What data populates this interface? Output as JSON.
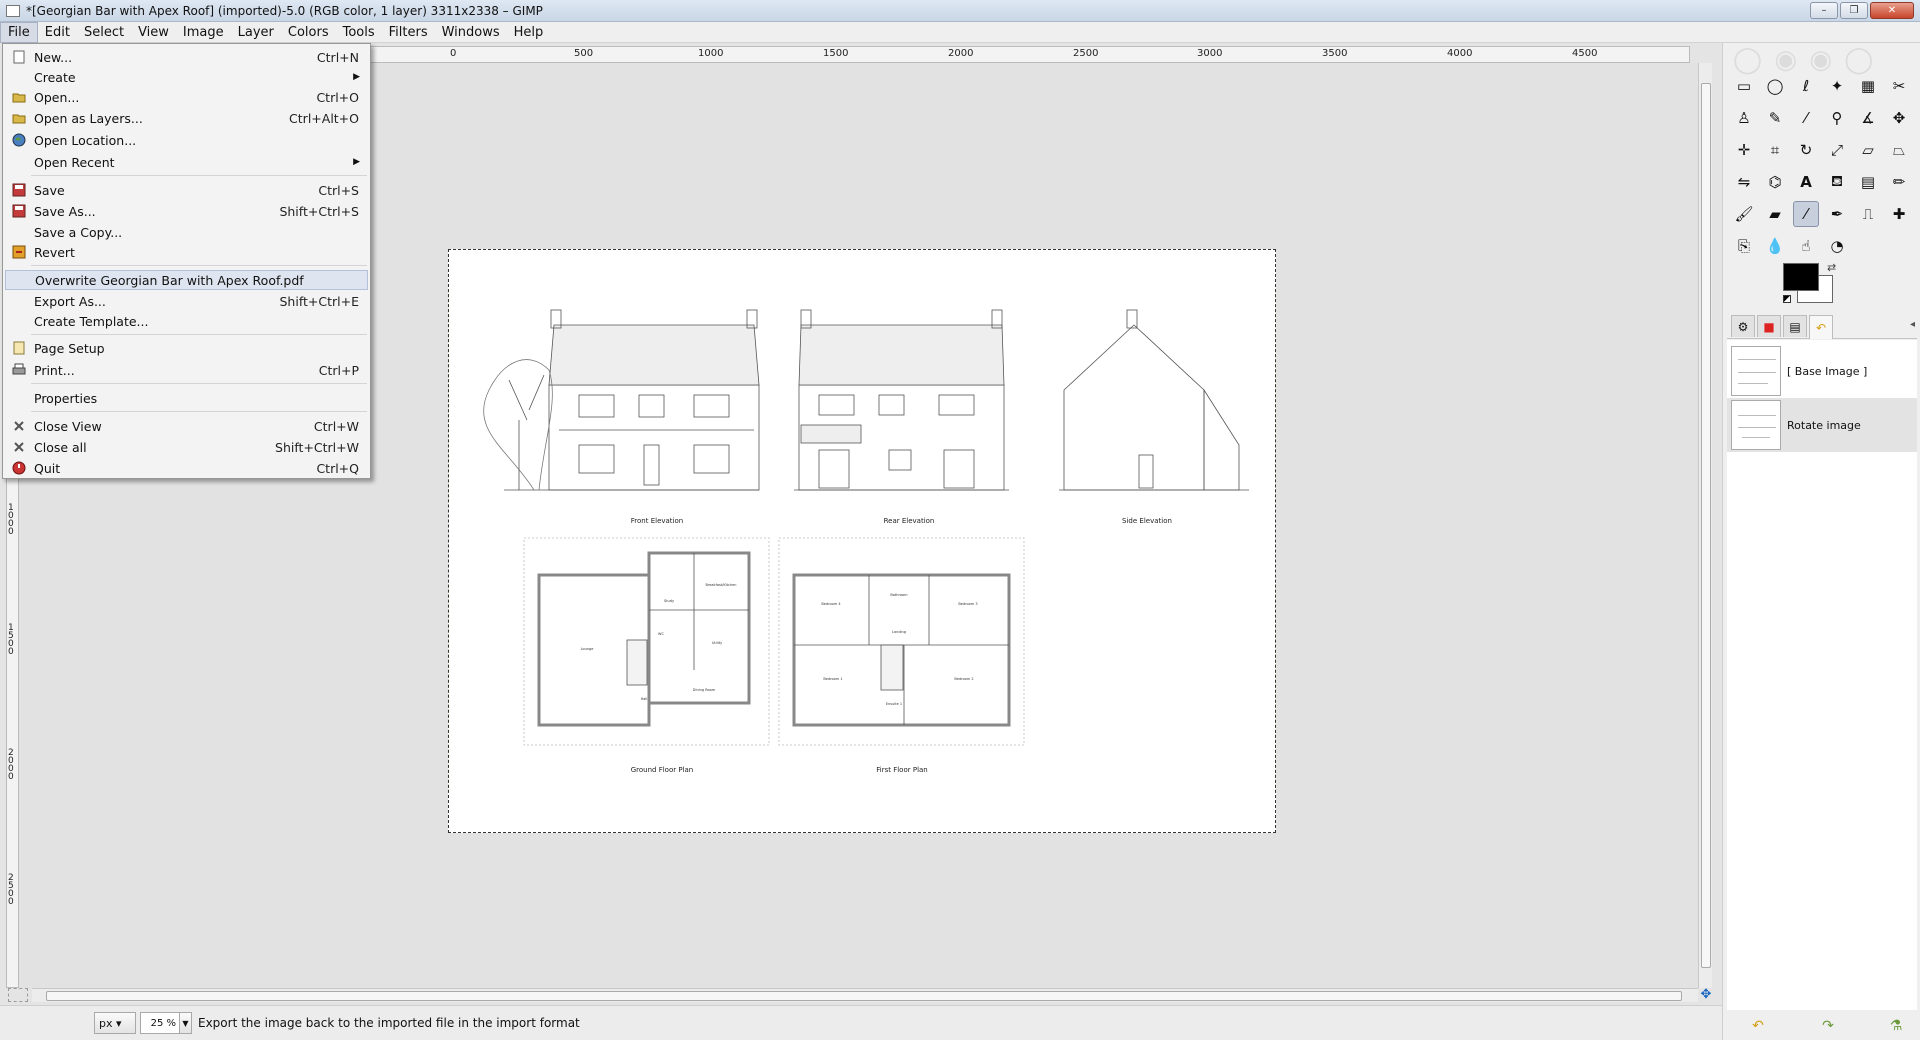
{
  "window": {
    "title": "*[Georgian Bar with Apex Roof] (imported)-5.0 (RGB color, 1 layer) 3311x2338 – GIMP",
    "controls": {
      "minimize": "–",
      "maximize": "❐",
      "close": "✕"
    }
  },
  "menubar": {
    "file": "File",
    "edit": "Edit",
    "select": "Select",
    "view": "View",
    "image": "Image",
    "layer": "Layer",
    "colors": "Colors",
    "tools": "Tools",
    "filters": "Filters",
    "windows": "Windows",
    "help": "Help"
  },
  "file_menu": {
    "new": {
      "label": "New...",
      "accel": "Ctrl+N",
      "icon": "new-doc-icon"
    },
    "create": {
      "label": "Create"
    },
    "open": {
      "label": "Open...",
      "accel": "Ctrl+O",
      "icon": "open-folder-icon"
    },
    "open_layers": {
      "label": "Open as Layers...",
      "accel": "Ctrl+Alt+O",
      "icon": "open-layers-icon"
    },
    "open_location": {
      "label": "Open Location...",
      "icon": "globe-icon"
    },
    "open_recent": {
      "label": "Open Recent"
    },
    "save": {
      "label": "Save",
      "accel": "Ctrl+S",
      "icon": "save-icon"
    },
    "save_as": {
      "label": "Save As...",
      "accel": "Shift+Ctrl+S",
      "icon": "save-as-icon"
    },
    "save_copy": {
      "label": "Save a Copy..."
    },
    "revert": {
      "label": "Revert",
      "icon": "revert-icon"
    },
    "overwrite": {
      "label": "Overwrite Georgian Bar with Apex Roof.pdf"
    },
    "export_as": {
      "label": "Export As...",
      "accel": "Shift+Ctrl+E"
    },
    "create_template": {
      "label": "Create Template..."
    },
    "page_setup": {
      "label": "Page Setup",
      "icon": "page-setup-icon"
    },
    "print": {
      "label": "Print...",
      "accel": "Ctrl+P",
      "icon": "print-icon"
    },
    "properties": {
      "label": "Properties"
    },
    "close_view": {
      "label": "Close View",
      "accel": "Ctrl+W",
      "icon": "close-icon"
    },
    "close_all": {
      "label": "Close all",
      "accel": "Shift+Ctrl+W",
      "icon": "close-all-icon"
    },
    "quit": {
      "label": "Quit",
      "accel": "Ctrl+Q",
      "icon": "quit-icon"
    }
  },
  "ruler": {
    "h_labels": [
      "0",
      "500",
      "1000",
      "1500",
      "2000",
      "2500",
      "3000",
      "3500",
      "4000",
      "4500"
    ],
    "v_labels": [
      "1000",
      "1500",
      "2000",
      "2500"
    ]
  },
  "drawing": {
    "captions": {
      "front": "Front Elevation",
      "rear": "Rear Elevation",
      "side": "Side Elevation",
      "ground": "Ground Floor Plan",
      "first": "First Floor Plan"
    },
    "room_labels": {
      "lounge": "Lounge",
      "study": "Study",
      "breakfast": "Breakfast/Kitchen",
      "utility": "Utility",
      "dining": "Dining Room",
      "wc": "WC",
      "hall": "Hall",
      "bed4": "Bedroom 4",
      "bath": "Bathroom",
      "bed3": "Bedroom 3",
      "landing": "Landing",
      "bed1": "Bedroom 1",
      "bed2": "Bedroom 2",
      "ensuite": "Ensuite 1"
    }
  },
  "statusbar": {
    "unit": "px",
    "zoom": "25 %",
    "message": "Export the image back to the imported file in the import format"
  },
  "dock": {
    "history": [
      {
        "label": "[ Base Image ]"
      },
      {
        "label": "Rotate image"
      }
    ],
    "tabs": [
      "tool-options-tab",
      "device-status-tab",
      "layers-tab",
      "undo-history-tab"
    ],
    "colors": {
      "foreground": "#000000",
      "background": "#ffffff"
    }
  }
}
